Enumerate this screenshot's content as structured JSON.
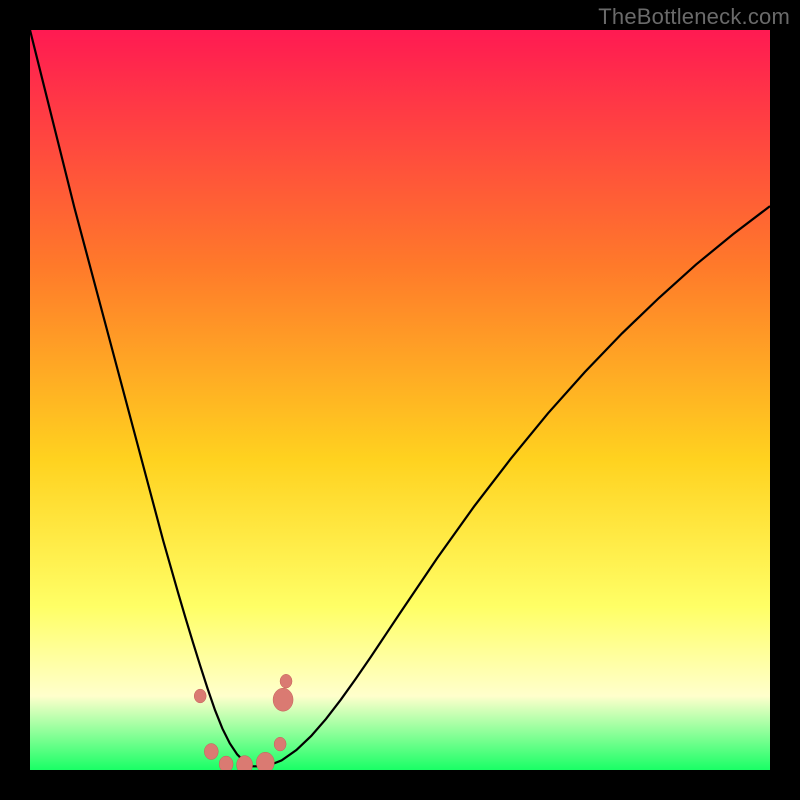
{
  "watermark": "TheBottleneck.com",
  "colors": {
    "page_bg": "#000000",
    "grad_top": "#ff1a52",
    "grad_mid1": "#ff7a2a",
    "grad_mid2": "#ffd21f",
    "grad_mid3": "#ffff66",
    "grad_mid4": "#ffffcc",
    "grad_bottom": "#19ff66",
    "curve": "#000000",
    "marker_fill": "#da7a72",
    "marker_stroke": "#c46058"
  },
  "chart_data": {
    "type": "line",
    "title": "",
    "xlabel": "",
    "ylabel": "",
    "xlim": [
      0,
      100
    ],
    "ylim": [
      0,
      100
    ],
    "grid": false,
    "x": [
      0,
      2,
      4,
      6,
      8,
      10,
      12,
      14,
      16,
      18,
      20,
      21,
      22,
      23,
      24,
      25,
      26,
      27,
      28,
      29,
      30,
      32,
      34,
      36,
      38,
      40,
      42,
      44,
      46,
      48,
      50,
      55,
      60,
      65,
      70,
      75,
      80,
      85,
      90,
      95,
      100
    ],
    "values": [
      100,
      92,
      84,
      76,
      68.5,
      61,
      53.5,
      46,
      38.5,
      31,
      24,
      20.6,
      17.3,
      14.1,
      11,
      8.1,
      5.6,
      3.6,
      2.1,
      1.1,
      0.5,
      0.5,
      1.3,
      2.7,
      4.6,
      6.9,
      9.5,
      12.3,
      15.2,
      18.2,
      21.2,
      28.6,
      35.6,
      42.1,
      48.2,
      53.8,
      59.0,
      63.8,
      68.3,
      72.4,
      76.2
    ],
    "markers": [
      {
        "x": 23.0,
        "y": 10.0,
        "r": 6
      },
      {
        "x": 24.5,
        "y": 2.5,
        "r": 7
      },
      {
        "x": 26.5,
        "y": 0.8,
        "r": 7
      },
      {
        "x": 29.0,
        "y": 0.7,
        "r": 8
      },
      {
        "x": 31.8,
        "y": 1.0,
        "r": 9
      },
      {
        "x": 33.8,
        "y": 3.5,
        "r": 6
      },
      {
        "x": 34.2,
        "y": 9.5,
        "r": 10
      },
      {
        "x": 34.6,
        "y": 12.0,
        "r": 6
      }
    ]
  }
}
